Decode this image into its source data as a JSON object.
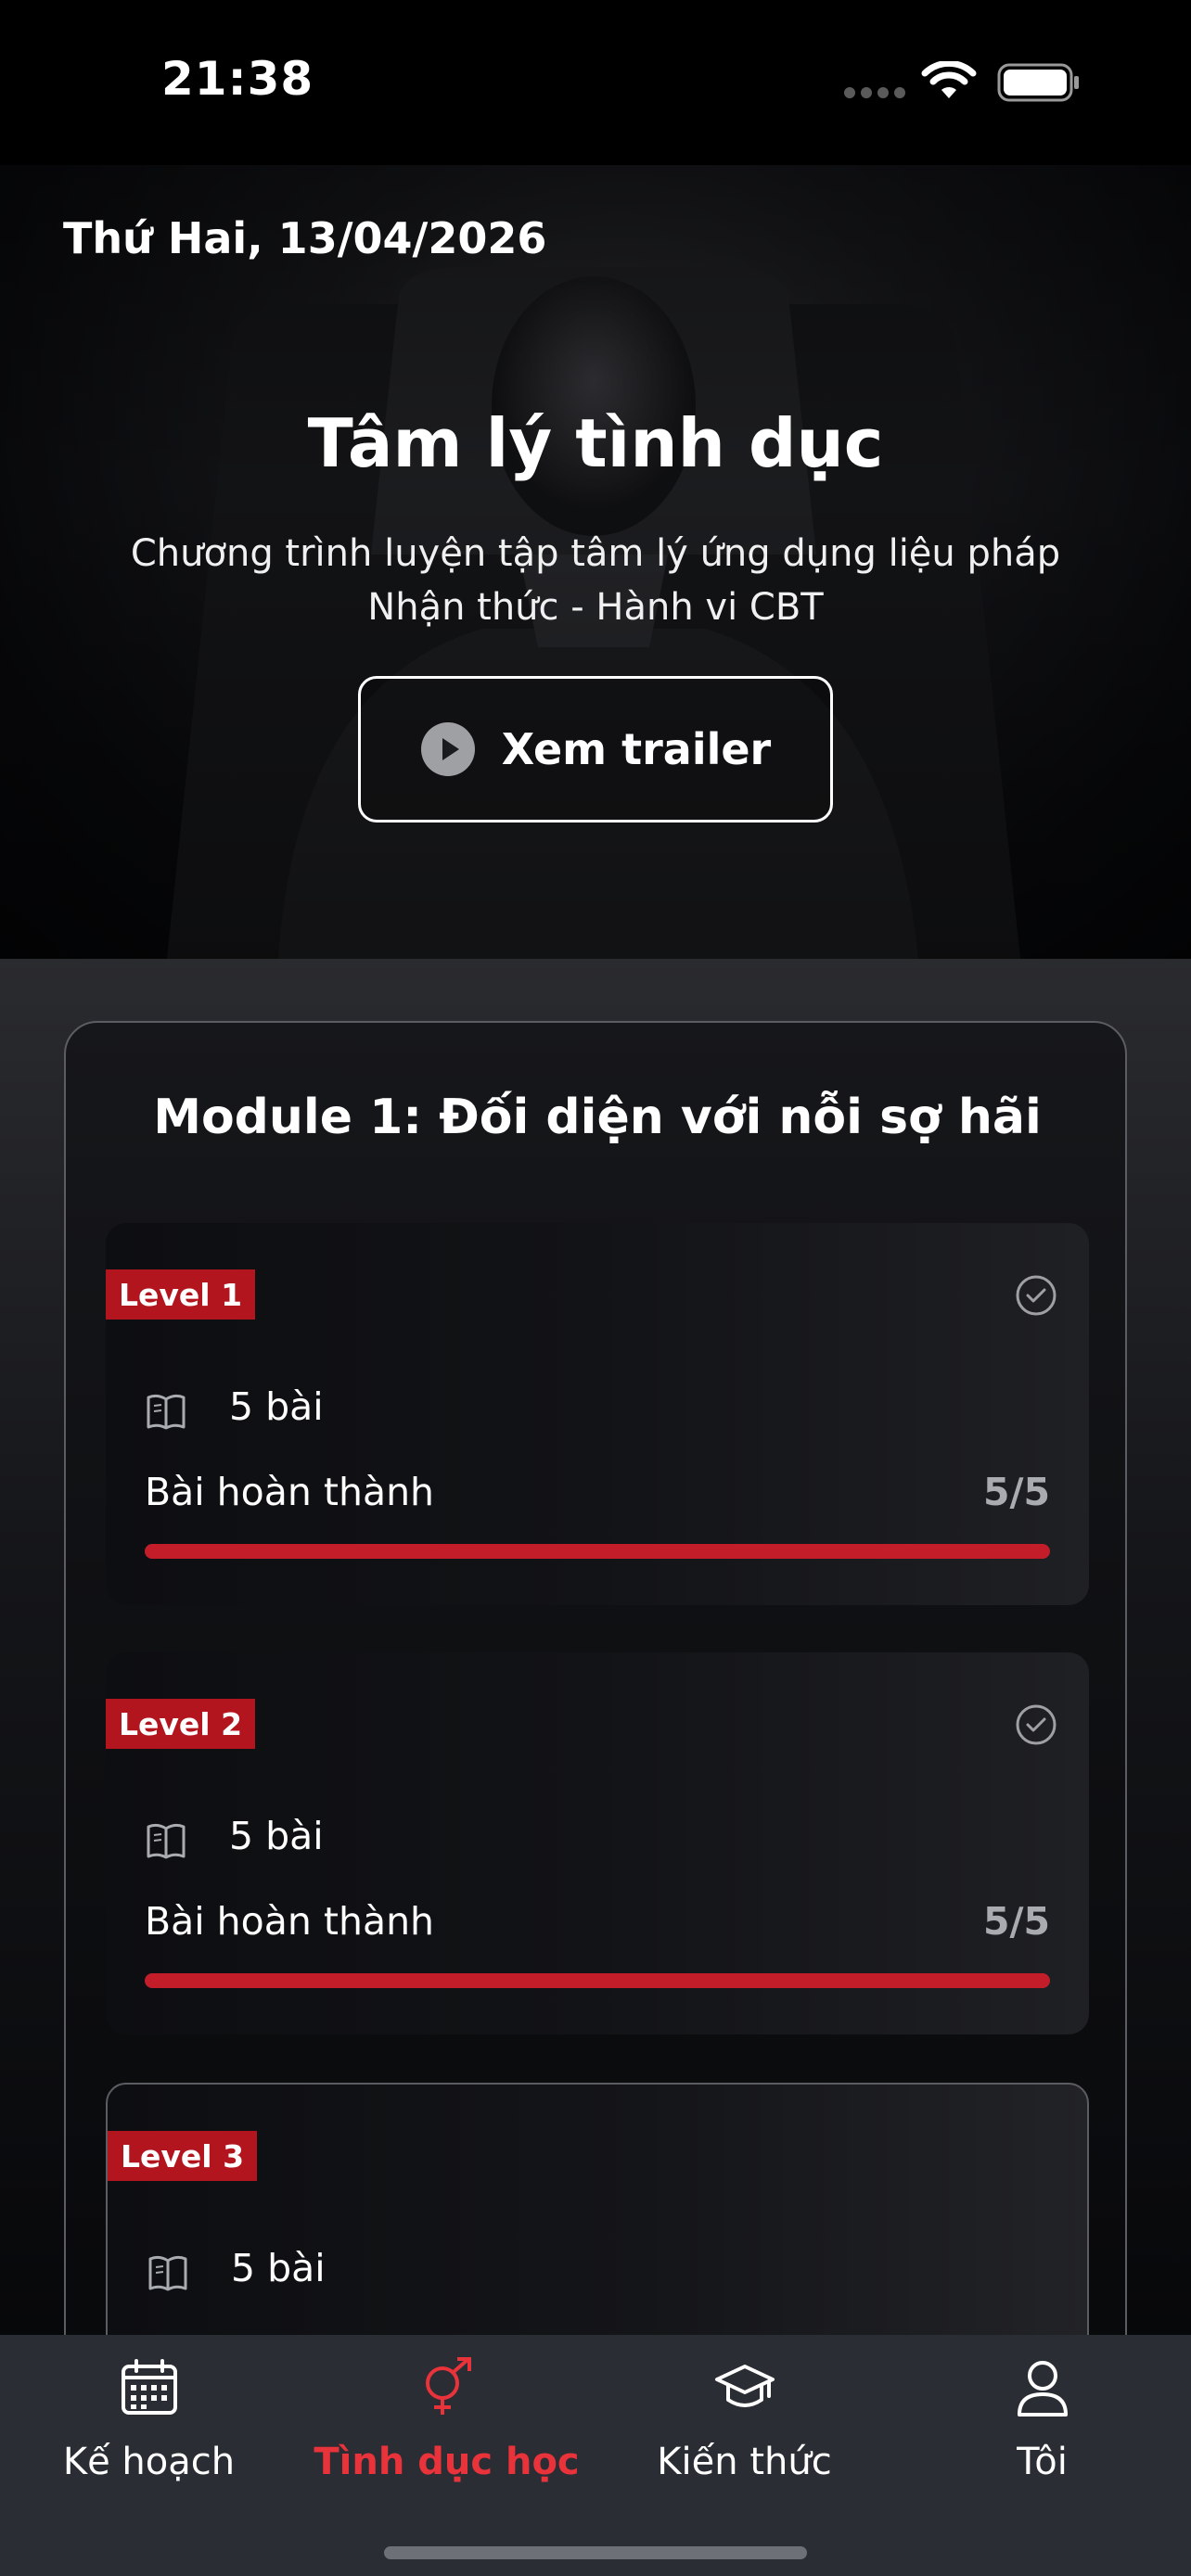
{
  "status_bar": {
    "time": "21:38"
  },
  "hero": {
    "date": "Thứ Hai, 13/04/2026",
    "title": "Tâm lý tình dục",
    "subtitle": "Chương trình luyện tập tâm lý ứng dụng liệu pháp Nhận thức - Hành vi CBT",
    "trailer_button": "Xem trailer"
  },
  "module": {
    "title": "Module 1: Đối diện với nỗi sợ hãi",
    "levels": [
      {
        "badge": "Level 1",
        "lessons": "5 bài",
        "done_label": "Bài hoàn thành",
        "done_count": "5/5",
        "progress": 1.0,
        "completed": true
      },
      {
        "badge": "Level 2",
        "lessons": "5 bài",
        "done_label": "Bài hoàn thành",
        "done_count": "5/5",
        "progress": 1.0,
        "completed": true
      },
      {
        "badge": "Level 3",
        "lessons": "5 bài"
      }
    ]
  },
  "tab_bar": {
    "tabs": [
      {
        "label": "Kế hoạch",
        "icon": "calendar-icon",
        "active": false
      },
      {
        "label": "Tình dục học",
        "icon": "gender-icon",
        "active": true
      },
      {
        "label": "Kiến thức",
        "icon": "graduation-cap-icon",
        "active": false
      },
      {
        "label": "Tôi",
        "icon": "user-icon",
        "active": false
      }
    ]
  },
  "colors": {
    "accent": "#c41d2a",
    "active_tab": "#e8333b",
    "badge": "#b3151e",
    "tab_bar": "#2b2d34"
  }
}
